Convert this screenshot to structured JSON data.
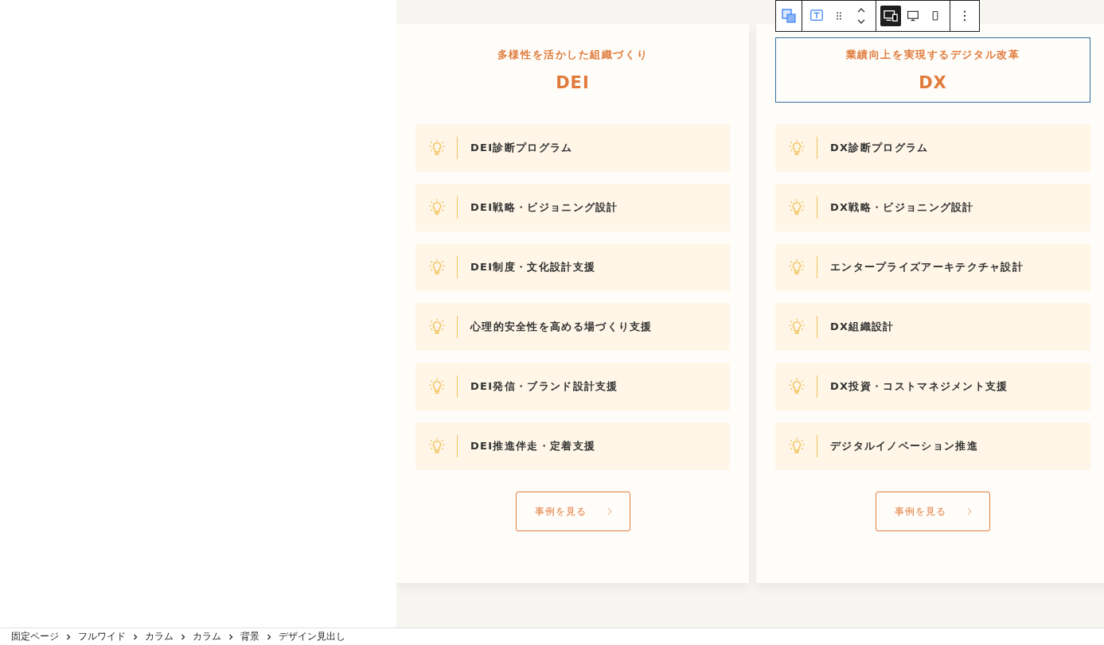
{
  "toolbar": {
    "groups": [
      {
        "buttons": [
          {
            "kind": "transform",
            "selected": false
          }
        ]
      },
      {
        "buttons": [
          {
            "kind": "text",
            "selected": false
          },
          {
            "kind": "drag",
            "selected": false
          },
          {
            "kind": "move",
            "selected": false
          }
        ]
      },
      {
        "buttons": [
          {
            "kind": "responsive",
            "selected": true
          },
          {
            "kind": "desktop",
            "selected": false
          },
          {
            "kind": "mobile",
            "selected": false
          }
        ]
      },
      {
        "buttons": [
          {
            "kind": "more",
            "selected": false
          }
        ]
      }
    ]
  },
  "cards": [
    {
      "subtitle": "多様性を活かした組織づくり",
      "title": "DEI",
      "heading_selected": false,
      "items": [
        "DEI診断プログラム",
        "DEI戦略・ビジョニング設計",
        "DEI制度・文化設計支援",
        "心理的安全性を高める場づくり支援",
        "DEI発信・ブランド設計支援",
        "DEI推進伴走・定着支援"
      ],
      "button": "事例を見る"
    },
    {
      "subtitle": "業績向上を実現するデジタル改革",
      "title": "DX",
      "heading_selected": true,
      "items": [
        "DX診断プログラム",
        "DX戦略・ビジョニング設計",
        "エンタープライズアーキテクチャ設計",
        "DX組織設計",
        "DX投資・コストマネジメント支援",
        "デジタルイノベーション推進"
      ],
      "button": "事例を見る"
    }
  ],
  "breadcrumb": [
    "固定ページ",
    "フルワイド",
    "カラム",
    "カラム",
    "背景",
    "デザイン見出し"
  ]
}
